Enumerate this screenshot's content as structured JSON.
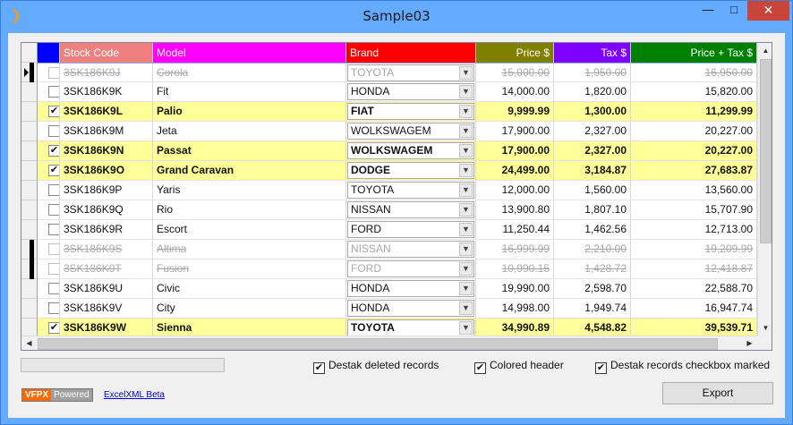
{
  "window": {
    "title": "Sample03",
    "min_glyph": "—",
    "max_glyph": "□",
    "close_glyph": "✕",
    "icon_glyph": "❯"
  },
  "grid": {
    "columns": [
      {
        "key": "sel",
        "label": "",
        "bg": "#0000ff"
      },
      {
        "key": "stock",
        "label": "Stock Code",
        "bg": "#f08080"
      },
      {
        "key": "model",
        "label": "Model",
        "bg": "#ff00ff"
      },
      {
        "key": "brand",
        "label": "Brand",
        "bg": "#ff0000"
      },
      {
        "key": "price",
        "label": "Price $",
        "bg": "#808000"
      },
      {
        "key": "tax",
        "label": "Tax $",
        "bg": "#8000ff"
      },
      {
        "key": "total",
        "label": "Price + Tax $",
        "bg": "#008000"
      }
    ],
    "rows": [
      {
        "checked": false,
        "status": "deleted",
        "current": true,
        "stock": "3SK186K9J",
        "model": "Corola",
        "brand": "TOYOTA",
        "price": "15,000.00",
        "tax": "1,950.00",
        "total": "16,950.00"
      },
      {
        "checked": false,
        "status": "normal",
        "stock": "3SK186K9K",
        "model": "Fit",
        "brand": "HONDA",
        "price": "14,000.00",
        "tax": "1,820.00",
        "total": "15,820.00"
      },
      {
        "checked": true,
        "status": "marked",
        "stock": "3SK186K9L",
        "model": "Palio",
        "brand": "FIAT",
        "price": "9,999.99",
        "tax": "1,300.00",
        "total": "11,299.99"
      },
      {
        "checked": false,
        "status": "normal",
        "stock": "3SK186K9M",
        "model": "Jeta",
        "brand": "WOLKSWAGEM",
        "price": "17,900.00",
        "tax": "2,327.00",
        "total": "20,227.00"
      },
      {
        "checked": true,
        "status": "marked",
        "stock": "3SK186K9N",
        "model": "Passat",
        "brand": "WOLKSWAGEM",
        "price": "17,900.00",
        "tax": "2,327.00",
        "total": "20,227.00"
      },
      {
        "checked": true,
        "status": "marked",
        "stock": "3SK186K9O",
        "model": "Grand Caravan",
        "brand": "DODGE",
        "price": "24,499.00",
        "tax": "3,184.87",
        "total": "27,683.87"
      },
      {
        "checked": false,
        "status": "normal",
        "stock": "3SK186K9P",
        "model": "Yaris",
        "brand": "TOYOTA",
        "price": "12,000.00",
        "tax": "1,560.00",
        "total": "13,560.00"
      },
      {
        "checked": false,
        "status": "normal",
        "stock": "3SK186K9Q",
        "model": "Rio",
        "brand": "NISSAN",
        "price": "13,900.80",
        "tax": "1,807.10",
        "total": "15,707.90"
      },
      {
        "checked": false,
        "status": "normal",
        "stock": "3SK186K9R",
        "model": "Escort",
        "brand": "FORD",
        "price": "11,250.44",
        "tax": "1,462.56",
        "total": "12,713.00"
      },
      {
        "checked": false,
        "status": "deleted",
        "stock": "3SK186K9S",
        "model": "Altima",
        "brand": "NISSAN",
        "price": "16,999.99",
        "tax": "2,210.00",
        "total": "19,209.99"
      },
      {
        "checked": false,
        "status": "deleted",
        "stock": "3SK186K9T",
        "model": "Fusion",
        "brand": "FORD",
        "price": "10,990.15",
        "tax": "1,428.72",
        "total": "12,418.87"
      },
      {
        "checked": false,
        "status": "normal",
        "stock": "3SK186K9U",
        "model": "Civic",
        "brand": "HONDA",
        "price": "19,990.00",
        "tax": "2,598.70",
        "total": "22,588.70"
      },
      {
        "checked": false,
        "status": "normal",
        "stock": "3SK186K9V",
        "model": "City",
        "brand": "HONDA",
        "price": "14,998.00",
        "tax": "1,949.74",
        "total": "16,947.74"
      },
      {
        "checked": true,
        "status": "marked",
        "stock": "3SK186K9W",
        "model": "Sienna",
        "brand": "TOYOTA",
        "price": "34,990.89",
        "tax": "4,548.82",
        "total": "39,539.71"
      }
    ],
    "row_colors": {
      "marked": "#ffff99",
      "deleted_text": "#a8a8a8"
    },
    "check_glyph": "✔",
    "dropdown_glyph": "▼",
    "scroll_up_glyph": "▲",
    "scroll_down_glyph": "▼",
    "scroll_left_glyph": "◀",
    "scroll_right_glyph": "▶"
  },
  "options": {
    "destak_deleted": {
      "label": "Destak deleted records",
      "checked": true
    },
    "colored_header": {
      "label": "Colored header",
      "checked": true
    },
    "destak_marked": {
      "label": "Destak records checkbox marked",
      "checked": true
    }
  },
  "footer": {
    "badge_left": "VFPX",
    "badge_right": "Powered",
    "link": "ExcelXML Beta",
    "export_label": "Export"
  }
}
